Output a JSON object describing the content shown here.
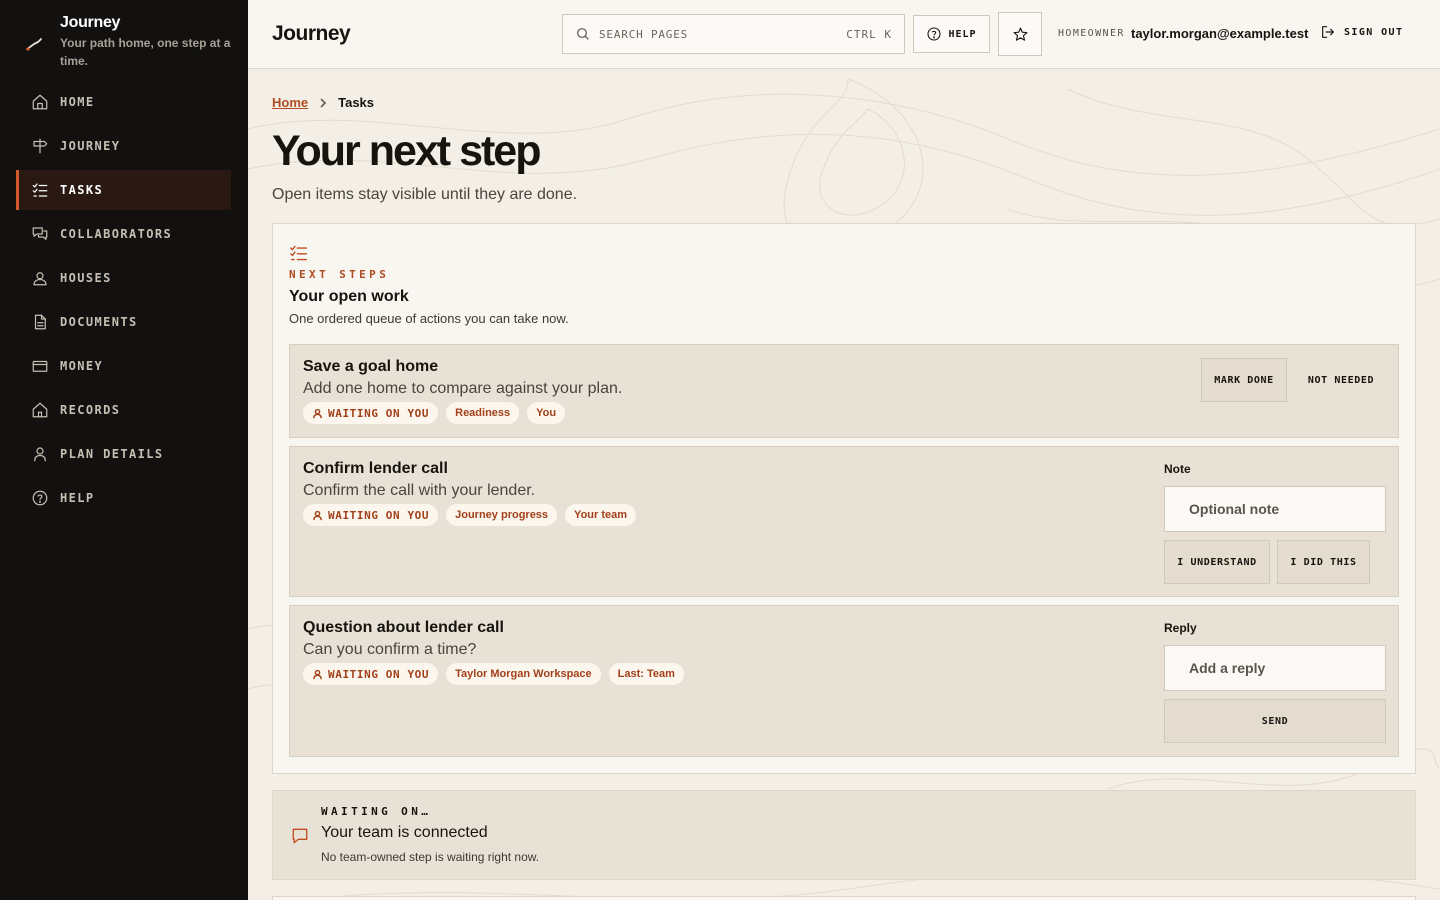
{
  "brand": {
    "title": "Journey",
    "tagline": "Your path home, one step at a time."
  },
  "sidebar": {
    "items": [
      {
        "label": "HOME",
        "icon": "home-icon",
        "active": false
      },
      {
        "label": "JOURNEY",
        "icon": "signpost-icon",
        "active": false
      },
      {
        "label": "TASKS",
        "icon": "checklist-icon",
        "active": true
      },
      {
        "label": "COLLABORATORS",
        "icon": "chat-icon",
        "active": false
      },
      {
        "label": "HOUSES",
        "icon": "house-user-icon",
        "active": false
      },
      {
        "label": "DOCUMENTS",
        "icon": "document-icon",
        "active": false
      },
      {
        "label": "MONEY",
        "icon": "card-icon",
        "active": false
      },
      {
        "label": "RECORDS",
        "icon": "records-icon",
        "active": false
      },
      {
        "label": "PLAN DETAILS",
        "icon": "user-icon",
        "active": false
      },
      {
        "label": "HELP",
        "icon": "help-icon",
        "active": false
      }
    ]
  },
  "topbar": {
    "title": "Journey",
    "search_placeholder": "SEARCH PAGES",
    "search_shortcut": "CTRL K",
    "help_label": "HELP",
    "role": "HOMEOWNER",
    "email": "taylor.morgan@example.test",
    "signout_label": "SIGN OUT"
  },
  "breadcrumb": {
    "home": "Home",
    "current": "Tasks"
  },
  "page": {
    "title": "Your next step",
    "subtitle": "Open items stay visible until they are done."
  },
  "panel": {
    "eyebrow": "NEXT STEPS",
    "title": "Your open work",
    "description": "One ordered queue of actions you can take now."
  },
  "tasks": [
    {
      "title": "Save a goal home",
      "description": "Add one home to compare against your plan.",
      "status": "WAITING ON YOU",
      "chips": [
        "Readiness",
        "You"
      ],
      "actions": [
        "MARK DONE",
        "NOT NEEDED"
      ]
    },
    {
      "title": "Confirm lender call",
      "description": "Confirm the call with your lender.",
      "status": "WAITING ON YOU",
      "chips": [
        "Journey progress",
        "Your team"
      ],
      "field_label": "Note",
      "field_placeholder": "Optional note",
      "actions": [
        "I UNDERSTAND",
        "I DID THIS"
      ]
    },
    {
      "title": "Question about lender call",
      "description": "Can you confirm a time?",
      "status": "WAITING ON YOU",
      "chips": [
        "Taylor Morgan Workspace",
        "Last: Team"
      ],
      "field_label": "Reply",
      "field_placeholder": "Add a reply",
      "actions": [
        "SEND"
      ]
    }
  ],
  "waiting": {
    "eyebrow": "WAITING ON…",
    "title": "Your team is connected",
    "description": "No team-owned step is waiting right now."
  },
  "colors": {
    "accent": "#c24d22",
    "sidebar_bg": "#121110",
    "active_item_bg": "#2a1812",
    "page_bg": "#f3efe6",
    "task_bg": "#e8e1d5"
  }
}
